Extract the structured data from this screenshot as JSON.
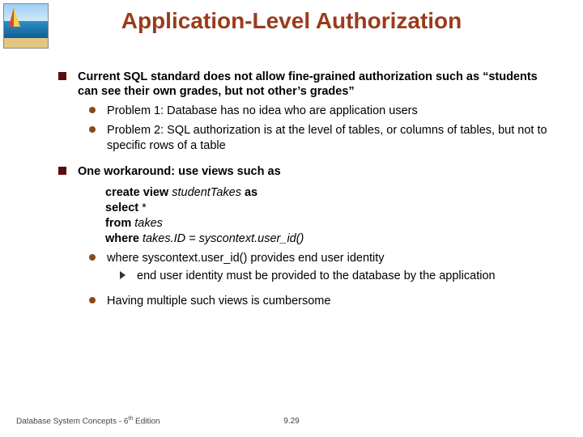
{
  "title": "Application-Level Authorization",
  "b1": {
    "main": "Current SQL standard does not allow fine-grained authorization such as “students can see their own grades, but not other’s grades”",
    "p1": "Problem 1: Database has no idea who are application users",
    "p2": "Problem 2: SQL authorization is at the level of tables, or columns of tables, but not to specific rows of a table"
  },
  "b2": {
    "main": "One workaround: use views such as",
    "code": {
      "l1a": "create view ",
      "l1b": "studentTakes ",
      "l1c": "as",
      "l2a": "select",
      "l2b": " *",
      "l3a": "from ",
      "l3b": "takes",
      "l4a": "where ",
      "l4b": "takes.ID = syscontext.user_id()"
    },
    "s1": "where syscontext.user_id() provides end user identity",
    "s1a": "end user identity must be provided to the database by the application",
    "s2": "Having multiple such views is cumbersome"
  },
  "footer": {
    "left_a": "Database System Concepts - 6",
    "left_b": "th",
    "left_c": " Edition",
    "center": "9.29"
  }
}
